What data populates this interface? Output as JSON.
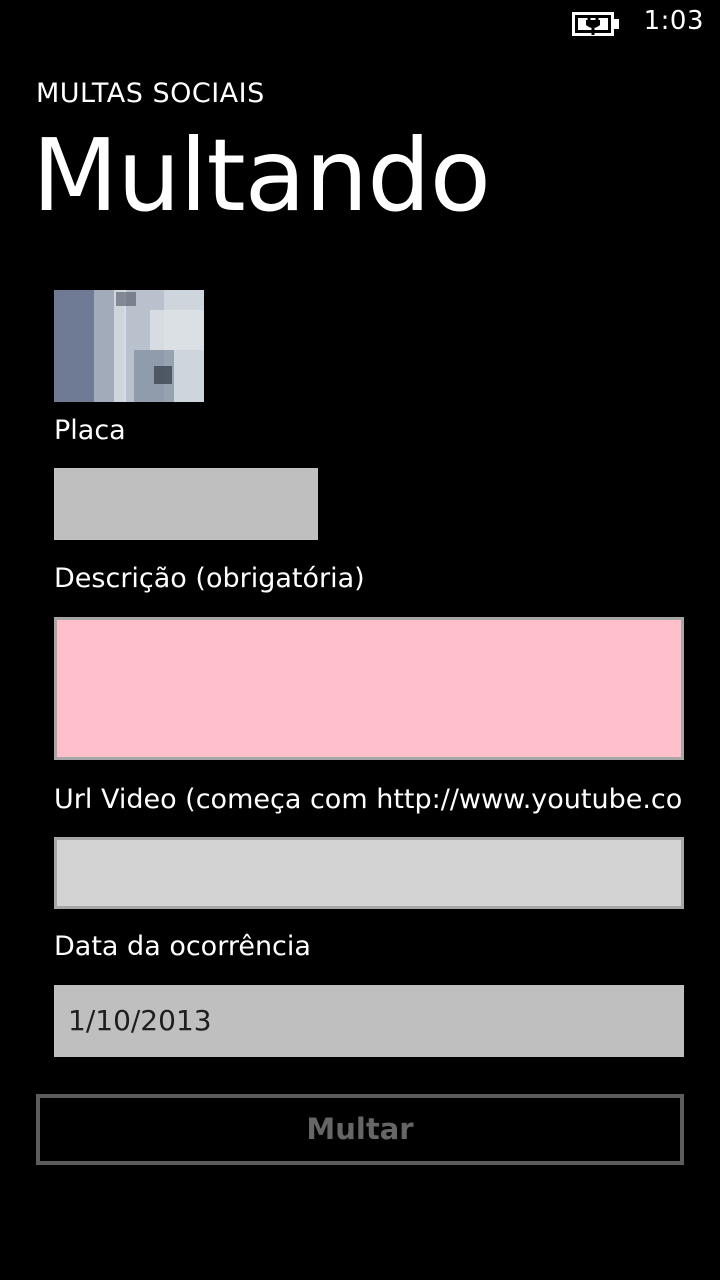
{
  "status_bar": {
    "time": "1:03",
    "battery_icon": "battery-charging-icon"
  },
  "header": {
    "app_title": "MULTAS SOCIAIS",
    "page_title": "Multando"
  },
  "form": {
    "photo_icon": "photo-thumbnail",
    "placa_label": "Placa",
    "placa_value": "",
    "descricao_label": "Descrição (obrigatória)",
    "descricao_value": "",
    "url_label": "Url Video (começa com http://www.youtube.com",
    "url_value": "",
    "data_label": "Data da ocorrência",
    "data_value": "1/10/2013",
    "submit_label": "Multar"
  },
  "colors": {
    "background": "#000000",
    "text": "#ffffff",
    "placa_bg": "#bfbfbf",
    "descricao_bg": "#ffc0cb",
    "url_bg": "#d3d3d3",
    "date_bg": "#bfbfbf",
    "button_border": "#5c5c5c",
    "button_text": "#666666"
  }
}
